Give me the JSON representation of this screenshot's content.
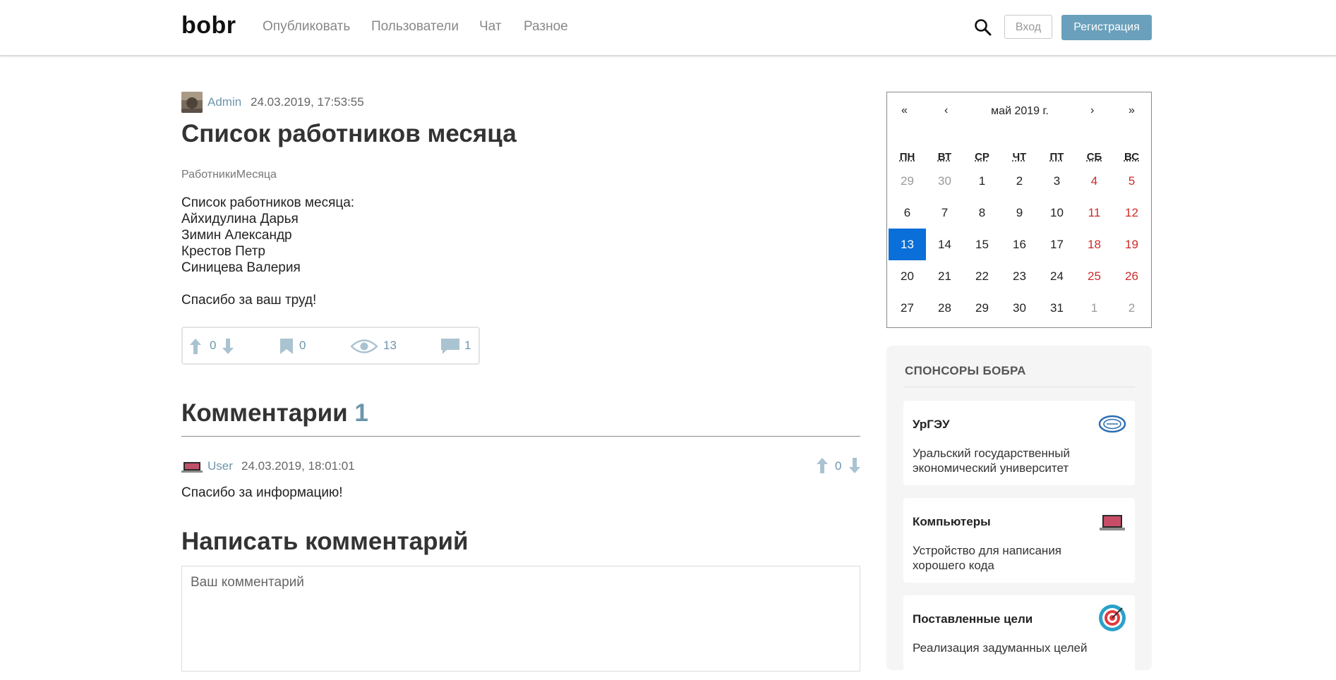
{
  "header": {
    "brand": "bobr",
    "nav": [
      "Опубликовать",
      "Пользователи",
      "Чат",
      "Разное"
    ],
    "login": "Вход",
    "register": "Регистрация"
  },
  "post": {
    "author": "Admin",
    "date": "24.03.2019, 17:53:55",
    "title": "Список работников месяца",
    "tag": "РаботникиМесяца",
    "body": [
      "Список работников месяца:",
      "Айхидулина Дарья",
      "Зимин Александр",
      "Крестов Петр",
      "Синицева Валерия"
    ],
    "thanks": "Спасибо за ваш труд!",
    "stats": {
      "rating": "0",
      "bookmarks": "0",
      "views": "13",
      "comments": "1"
    }
  },
  "comments": {
    "title": "Комментарии",
    "count": "1",
    "items": [
      {
        "author": "User",
        "date": "24.03.2019, 18:01:01",
        "rating": "0",
        "text": "Спасибо за информацию!"
      }
    ]
  },
  "write": {
    "title": "Написать комментарий",
    "placeholder": "Ваш комментарий"
  },
  "calendar": {
    "prev_year": "«",
    "prev_month": "‹",
    "title": "май 2019 г.",
    "next_month": "›",
    "next_year": "»",
    "weekdays": [
      "ПН",
      "ВТ",
      "СР",
      "ЧТ",
      "ПТ",
      "СБ",
      "ВС"
    ],
    "weeks": [
      [
        "29",
        "30",
        "1",
        "2",
        "3",
        "4",
        "5"
      ],
      [
        "6",
        "7",
        "8",
        "9",
        "10",
        "11",
        "12"
      ],
      [
        "13",
        "14",
        "15",
        "16",
        "17",
        "18",
        "19"
      ],
      [
        "20",
        "21",
        "22",
        "23",
        "24",
        "25",
        "26"
      ],
      [
        "27",
        "28",
        "29",
        "30",
        "31",
        "1",
        "2"
      ]
    ],
    "today": "13",
    "colors": {
      "today": "#0a6fd8",
      "weekend": "#cc2a2a",
      "other": "#9a9a9a"
    }
  },
  "sponsors": {
    "title": "СПОНСОРЫ БОБРА",
    "items": [
      {
        "name": "УрГЭУ",
        "desc": "Уральский государственный экономический университет",
        "icon": "usue-logo-icon"
      },
      {
        "name": "Компьютеры",
        "desc": "Устройство для написания хорошего кода",
        "icon": "laptop-icon"
      },
      {
        "name": "Поставленные цели",
        "desc": "Реализация задуманных целей",
        "icon": "target-icon"
      }
    ]
  },
  "colors": {
    "accent": "#6aa0bb",
    "link": "#6d96ad",
    "icon": "#aac3d1"
  }
}
